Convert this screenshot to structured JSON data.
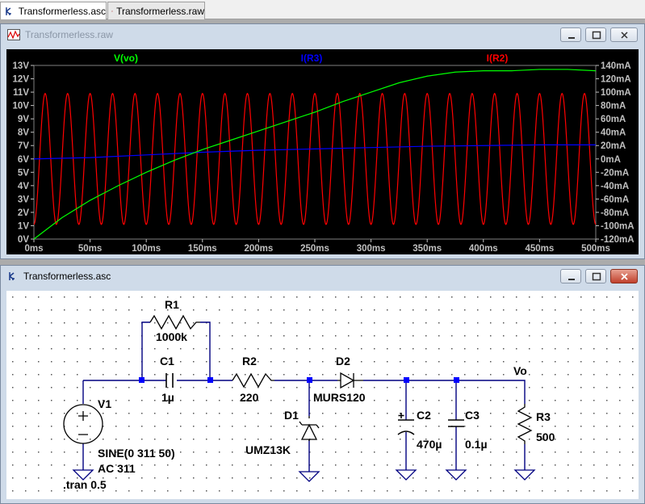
{
  "tabs": [
    {
      "label": "Transformerless.asc",
      "icon": "schematic-icon"
    },
    {
      "label": "Transformerless.raw",
      "icon": "waveform-icon"
    }
  ],
  "waveform_window": {
    "title": "Transformerless.raw"
  },
  "schematic_window": {
    "title": "Transformerless.asc"
  },
  "colors": {
    "vo": "#00ff00",
    "ir3": "#0000ff",
    "ir2": "#ff0000",
    "plot_bg": "#000000",
    "wire": "#000080",
    "node": "#0000ff"
  },
  "chart_data": {
    "type": "line",
    "x_label_ticks": [
      "0ms",
      "50ms",
      "100ms",
      "150ms",
      "200ms",
      "250ms",
      "300ms",
      "350ms",
      "400ms",
      "450ms",
      "500ms"
    ],
    "xlim": [
      0,
      500
    ],
    "y_left_ticks": [
      "0V",
      "1V",
      "2V",
      "3V",
      "4V",
      "5V",
      "6V",
      "7V",
      "8V",
      "9V",
      "10V",
      "11V",
      "12V",
      "13V"
    ],
    "ylim_left": [
      0,
      13
    ],
    "y_right_ticks": [
      "-120mA",
      "-100mA",
      "-80mA",
      "-60mA",
      "-40mA",
      "-20mA",
      "0mA",
      "20mA",
      "40mA",
      "60mA",
      "80mA",
      "100mA",
      "120mA",
      "140mA"
    ],
    "ylim_right": [
      -120,
      140
    ],
    "series": [
      {
        "name": "V(vo)",
        "axis": "left",
        "color": "#00ff00",
        "x": [
          0,
          25,
          50,
          75,
          100,
          125,
          150,
          175,
          200,
          225,
          250,
          275,
          300,
          325,
          350,
          375,
          400,
          425,
          450,
          475,
          500
        ],
        "values": [
          0,
          1.6,
          2.9,
          4.0,
          5.0,
          5.9,
          6.7,
          7.4,
          8.1,
          8.8,
          9.5,
          10.3,
          11.0,
          11.7,
          12.2,
          12.5,
          12.6,
          12.6,
          12.7,
          12.7,
          12.6
        ]
      },
      {
        "name": "I(R3)",
        "axis": "right",
        "color": "#0000ff",
        "x": [
          0,
          50,
          100,
          150,
          200,
          250,
          300,
          350,
          400,
          450,
          500
        ],
        "values": [
          0,
          2,
          6,
          10,
          13,
          15,
          17,
          19,
          20,
          21,
          21
        ]
      },
      {
        "name": "I(R2)",
        "axis": "right",
        "color": "#ff0000",
        "frequency_hz": 50,
        "amplitude_ma": 98,
        "values": [
          -98,
          98
        ]
      }
    ]
  },
  "schematic": {
    "components": {
      "r1": {
        "ref": "R1",
        "value": "1000k"
      },
      "c1": {
        "ref": "C1",
        "value": "1µ"
      },
      "r2": {
        "ref": "R2",
        "value": "220"
      },
      "d1": {
        "ref": "D1",
        "value": "UMZ13K"
      },
      "d2": {
        "ref": "D2",
        "value": "MURS120"
      },
      "c2": {
        "ref": "C2",
        "value": "470µ"
      },
      "c3": {
        "ref": "C3",
        "value": "0.1µ"
      },
      "r3": {
        "ref": "R3",
        "value": "500"
      },
      "v1": {
        "ref": "V1",
        "value": "SINE(0 311 50)",
        "ac": "AC 311"
      }
    },
    "net_label": "Vo",
    "directive": ".tran 0.5"
  }
}
